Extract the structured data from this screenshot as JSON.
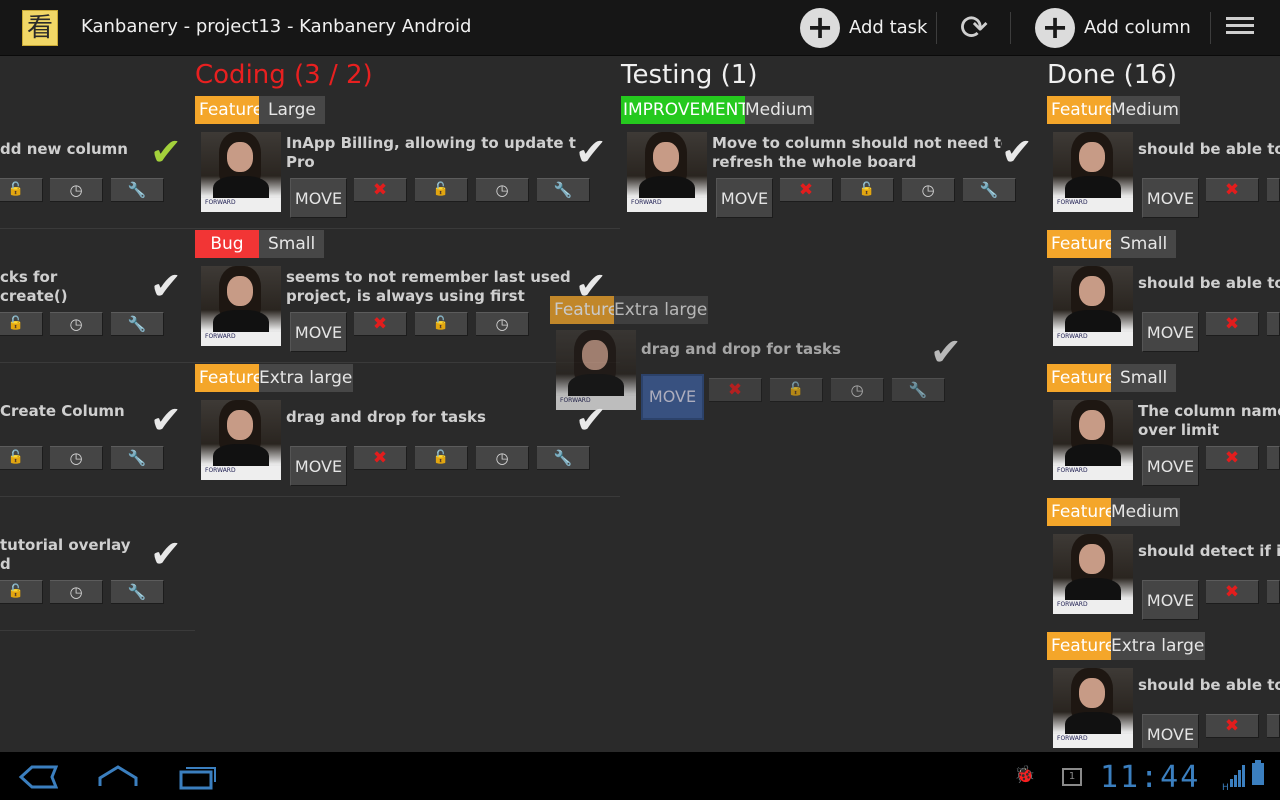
{
  "app": {
    "logo_glyph": "看",
    "title": "Kanbanery - project13 - Kanbanery Android"
  },
  "actionbar": {
    "add_task": "Add task",
    "add_column": "Add column",
    "icons": [
      "plus-icon",
      "sync-icon",
      "overflow-menu-icon"
    ]
  },
  "common": {
    "move": "MOVE",
    "check": "✔"
  },
  "left_column": {
    "tasks": [
      {
        "line1": "dd new column",
        "line2": ""
      },
      {
        "line1": "cks for",
        "line2": "create()"
      },
      {
        "line1": "Create Column",
        "line2": ""
      },
      {
        "line1": "tutorial overlay",
        "line2": "d"
      }
    ]
  },
  "columns": [
    {
      "title": "Coding (3 / 2)",
      "over_limit": true,
      "tasks": [
        {
          "type": "Feature",
          "size": "Large",
          "line1": "InApp Billing, allowing to update to",
          "line2": "Pro"
        },
        {
          "type": "Bug",
          "size": "Small",
          "line1": "seems to not remember last used",
          "line2": "project, is always using first"
        },
        {
          "type": "Feature",
          "size": "Extra large",
          "line1": "drag and drop for tasks",
          "line2": ""
        }
      ]
    },
    {
      "title": "Testing (1)",
      "over_limit": false,
      "tasks": [
        {
          "type": "IMPROVEMENT",
          "size": "Medium",
          "line1": "Move to column should not need to",
          "line2": "refresh the whole board"
        }
      ]
    },
    {
      "title": "Done (16)",
      "over_limit": false,
      "tasks": [
        {
          "type": "Feature",
          "size": "Medium",
          "line1": "should be able to c",
          "line2": ""
        },
        {
          "type": "Feature",
          "size": "Small",
          "line1": "should be able to l",
          "line2": ""
        },
        {
          "type": "Feature",
          "size": "Small",
          "line1": "The column name",
          "line2": "over limit"
        },
        {
          "type": "Feature",
          "size": "Medium",
          "line1": "should detect if it",
          "line2": ""
        },
        {
          "type": "Feature",
          "size": "Extra large",
          "line1": "should be able to c",
          "line2": ""
        }
      ]
    }
  ],
  "drag_ghost": {
    "type": "Feature",
    "size": "Extra large",
    "line1": "drag and drop for tasks"
  },
  "avatar_caption": "FORWARD",
  "status_bar": {
    "clock": "11:44",
    "network_type": "H",
    "notification_count": "1",
    "colors": {
      "accent": "#3b7fbf"
    }
  },
  "colors": {
    "feature": "#f4a62a",
    "bug": "#f23535",
    "improvement": "#25c91e",
    "over_limit": "#e82020"
  }
}
